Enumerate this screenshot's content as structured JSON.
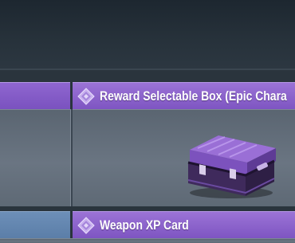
{
  "rows": [
    {
      "title": "Reward Selectable Box (Epic Chara",
      "icon": "diamond-icon",
      "item_icon": "purple-crate-icon"
    },
    {
      "title": "Weapon XP Card",
      "icon": "diamond-icon"
    }
  ],
  "colors": {
    "header_purple": "#8a60cc",
    "cell_gray": "#636e7a",
    "left_blue": "#6486b0",
    "background": "#2a343d"
  }
}
